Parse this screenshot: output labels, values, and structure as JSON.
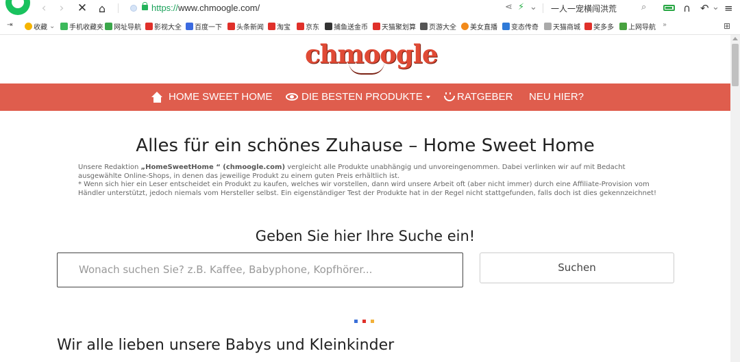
{
  "browser": {
    "url_scheme": "https://",
    "url_host": "www.chmoogle.com/",
    "search_box_text": "一人一宠横闯洪荒"
  },
  "bookmarks": [
    {
      "label": "收藏",
      "icon": "star-icon",
      "color": "#f5b400"
    },
    {
      "label": "手机收藏夹",
      "icon": "phone-icon",
      "color": "#3cb95b"
    },
    {
      "label": "网址导航",
      "icon": "navigation-icon",
      "color": "#3aa64a"
    },
    {
      "label": "影视大全",
      "icon": "video-icon",
      "color": "#e0302a"
    },
    {
      "label": "百度一下",
      "icon": "baidu-icon",
      "color": "#3b6ae0"
    },
    {
      "label": "头条新闻",
      "icon": "news-icon",
      "color": "#e0302a"
    },
    {
      "label": "淘宝",
      "icon": "taobao-icon",
      "color": "#e0302a"
    },
    {
      "label": "京东",
      "icon": "jd-icon",
      "color": "#e0302a"
    },
    {
      "label": "捕鱼送金币",
      "icon": "fish-icon",
      "color": "#333333"
    },
    {
      "label": "天猫聚划算",
      "icon": "tmall-icon",
      "color": "#e0302a"
    },
    {
      "label": "页游大全",
      "icon": "game-icon",
      "color": "#555555"
    },
    {
      "label": "美女直播",
      "icon": "live-icon",
      "color": "#f28a1a"
    },
    {
      "label": "变态传奇",
      "icon": "legend-icon",
      "color": "#2f7ad8"
    },
    {
      "label": "天猫商城",
      "icon": "tmall-mall-icon",
      "color": "#aaaaaa"
    },
    {
      "label": "奖多多",
      "icon": "prize-icon",
      "color": "#e0302a"
    },
    {
      "label": "上网导航",
      "icon": "check-icon",
      "color": "#48a23f"
    }
  ],
  "bookmarks_more": "»",
  "nav": {
    "home": "HOME SWEET HOME",
    "products": "DIE BESTEN PRODUKTE",
    "advice": "RATGEBER",
    "new": "NEU HIER?"
  },
  "main": {
    "headline": "Alles für ein schönes Zuhause – Home Sweet Home",
    "disclaimer_pre": "Unsere Redaktion ",
    "disclaimer_bold": "„HomeSweetHome “ (chmoogle.com)",
    "disclaimer_post": " vergleicht alle Produkte unabhängig und unvoreingenommen. Dabei verlinken wir auf mit Bedacht ausgewählte Online-Shops, in denen das jeweilige Produkt zu einem guten Preis erhältlich ist.",
    "disclaimer_note": "* Wenn sich hier ein Leser entscheidet ein Produkt zu kaufen, welches wir vorstellen, dann wird unsere Arbeit oft (aber nicht immer) durch eine Affiliate-Provision vom Händler unterstützt, jedoch niemals vom Hersteller selbst. Ein eigenständiger Test der Produkte hat in der Regel nicht stattgefunden, falls doch ist dies gekennzeichnet!",
    "search_heading": "Geben Sie hier Ihre Suche ein!",
    "search_placeholder": "Wonach suchen Sie? z.B. Kaffee, Babyphone, Kopfhörer...",
    "search_button": "Suchen",
    "section_title": "Wir alle lieben unsere Babys und Kleinkinder"
  },
  "site": {
    "logo_text": "chmoogle",
    "accent_color": "#df5d4d"
  },
  "dots_colors": [
    "#3a6fd8",
    "#e0302a",
    "#f2b13a"
  ]
}
